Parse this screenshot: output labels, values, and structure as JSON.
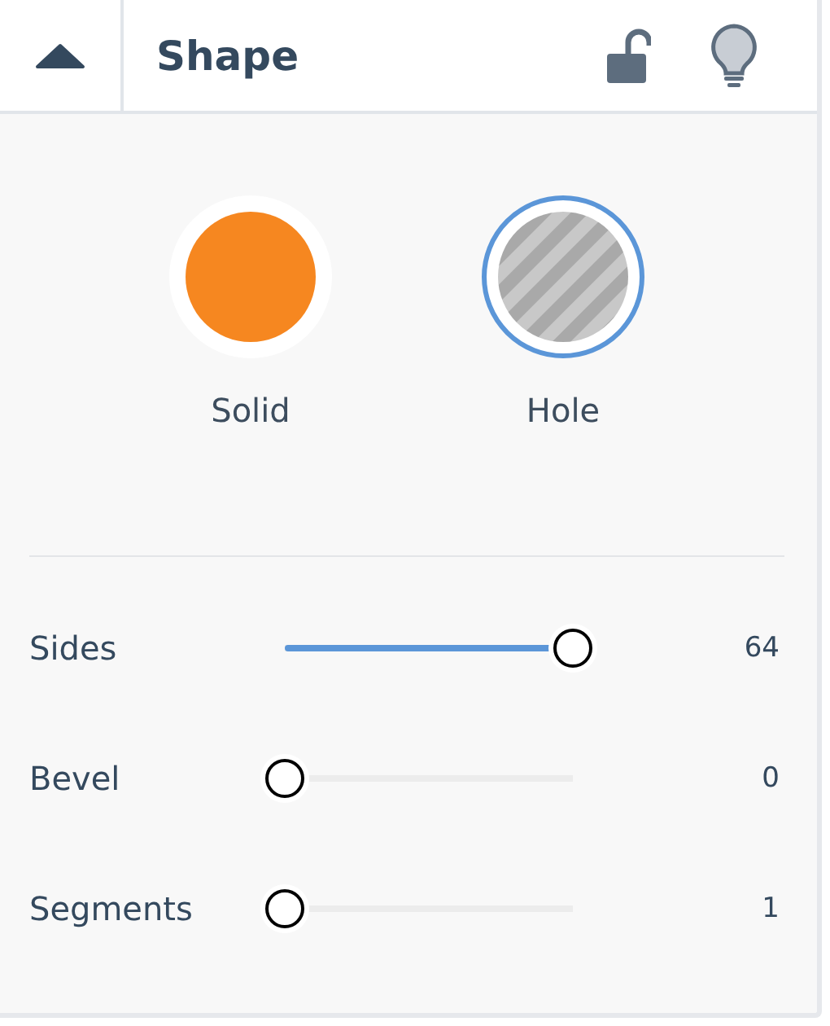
{
  "panel": {
    "title": "Shape",
    "expanded": true,
    "locked": false
  },
  "shape_types": [
    {
      "label": "Solid",
      "kind": "solid",
      "selected": false
    },
    {
      "label": "Hole",
      "kind": "hole",
      "selected": true
    }
  ],
  "properties": [
    {
      "name": "Sides",
      "level": 1,
      "reading": "64"
    },
    {
      "name": "Bevel",
      "level": 0,
      "reading": "0"
    },
    {
      "name": "Segments",
      "level": 0,
      "reading": "1"
    }
  ]
}
